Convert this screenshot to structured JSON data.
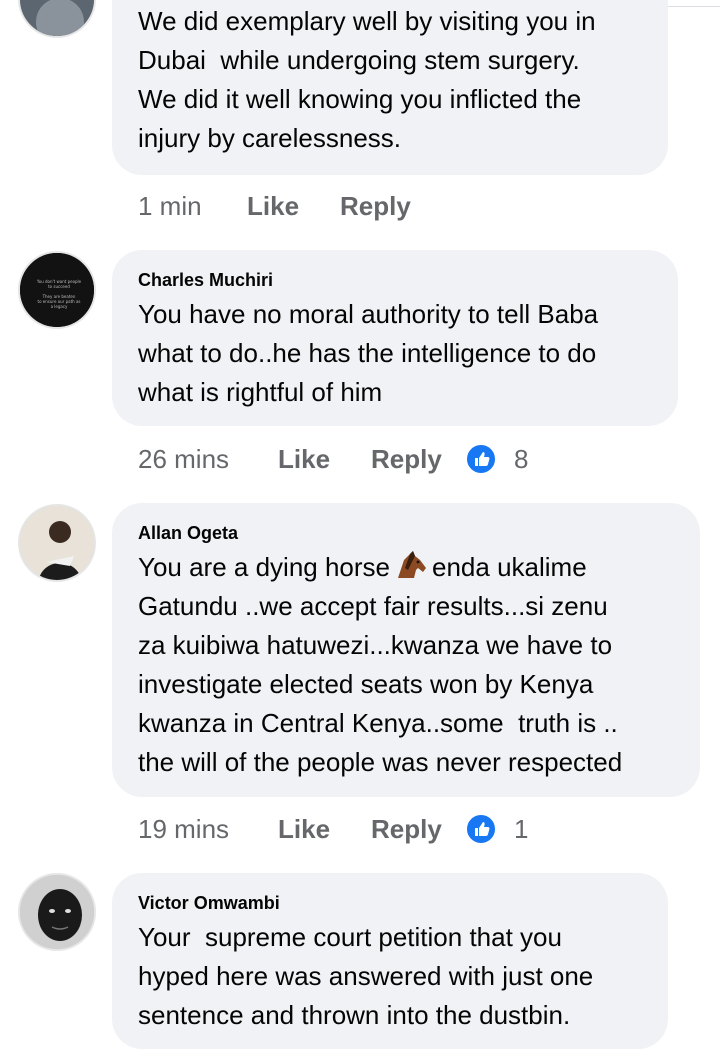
{
  "comments": [
    {
      "author": "",
      "lines": [
        "We did exemplary well by visiting you in",
        "Dubai  while undergoing stem surgery.",
        "We did it well knowing you inflicted the",
        "injury by carelessness."
      ],
      "time": "1 min",
      "like": "Like",
      "reply": "Reply",
      "reaction_count": ""
    },
    {
      "author": "Charles Muchiri",
      "lines": [
        "You have no moral authority to tell Baba",
        "what to do..he has the intelligence to do",
        "what is rightful of him"
      ],
      "time": "26 mins",
      "like": "Like",
      "reply": "Reply",
      "reaction_count": "8",
      "avatar_text": [
        "You don't want people",
        "to succeed",
        "They are beaten",
        "to ensure our path as",
        "a legacy"
      ]
    },
    {
      "author": "Allan Ogeta",
      "lines_before_emoji": "You are a dying horse",
      "lines_after_emoji": "enda ukalime",
      "lines": [
        "Gatundu ..we accept fair results...si zenu",
        "za kuibiwa hatuwezi...kwanza we have to",
        "investigate elected seats won by Kenya",
        "kwanza in Central Kenya..some  truth is ..",
        "the will of the people was never respected"
      ],
      "time": "19 mins",
      "like": "Like",
      "reply": "Reply",
      "reaction_count": "1"
    },
    {
      "author": "Victor Omwambi",
      "lines": [
        "Your  supreme court petition that you",
        "hyped here was answered with just one",
        "sentence and thrown into the dustbin."
      ]
    }
  ],
  "icons": {
    "reaction": "thumbs-up-icon",
    "emoji": "horse-face-emoji"
  },
  "colors": {
    "bubble": "#f0f2f5",
    "like_blue": "#1877f2",
    "meta_gray": "#65676b"
  }
}
